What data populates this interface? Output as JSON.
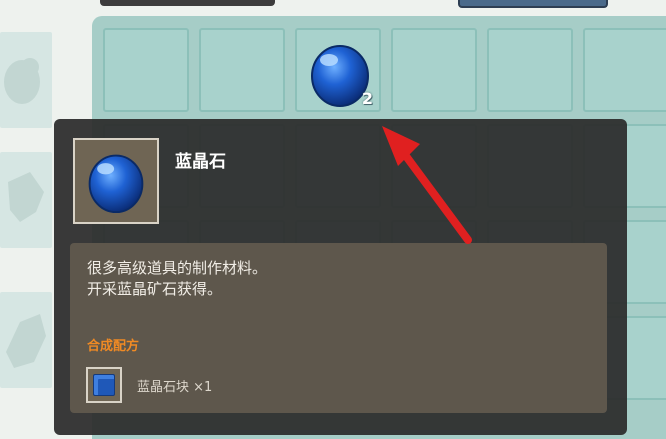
{
  "inventory": {
    "selected_item": {
      "icon": "blue-crystal-gem-icon",
      "count": "2"
    }
  },
  "tooltip": {
    "item_name": "蓝晶石",
    "description_lines": [
      "很多高级道具的制作材料。",
      "开采蓝晶矿石获得。"
    ],
    "recipe_title": "合成配方",
    "recipe": {
      "ingredient_icon": "blue-crystal-block-icon",
      "ingredient_label": "蓝晶石块 ×1"
    }
  },
  "colors": {
    "accent_orange": "#f08a24",
    "gem_blue": "#1f58b8",
    "arrow_red": "#e02020",
    "slot_teal": "#a8d2cc"
  }
}
